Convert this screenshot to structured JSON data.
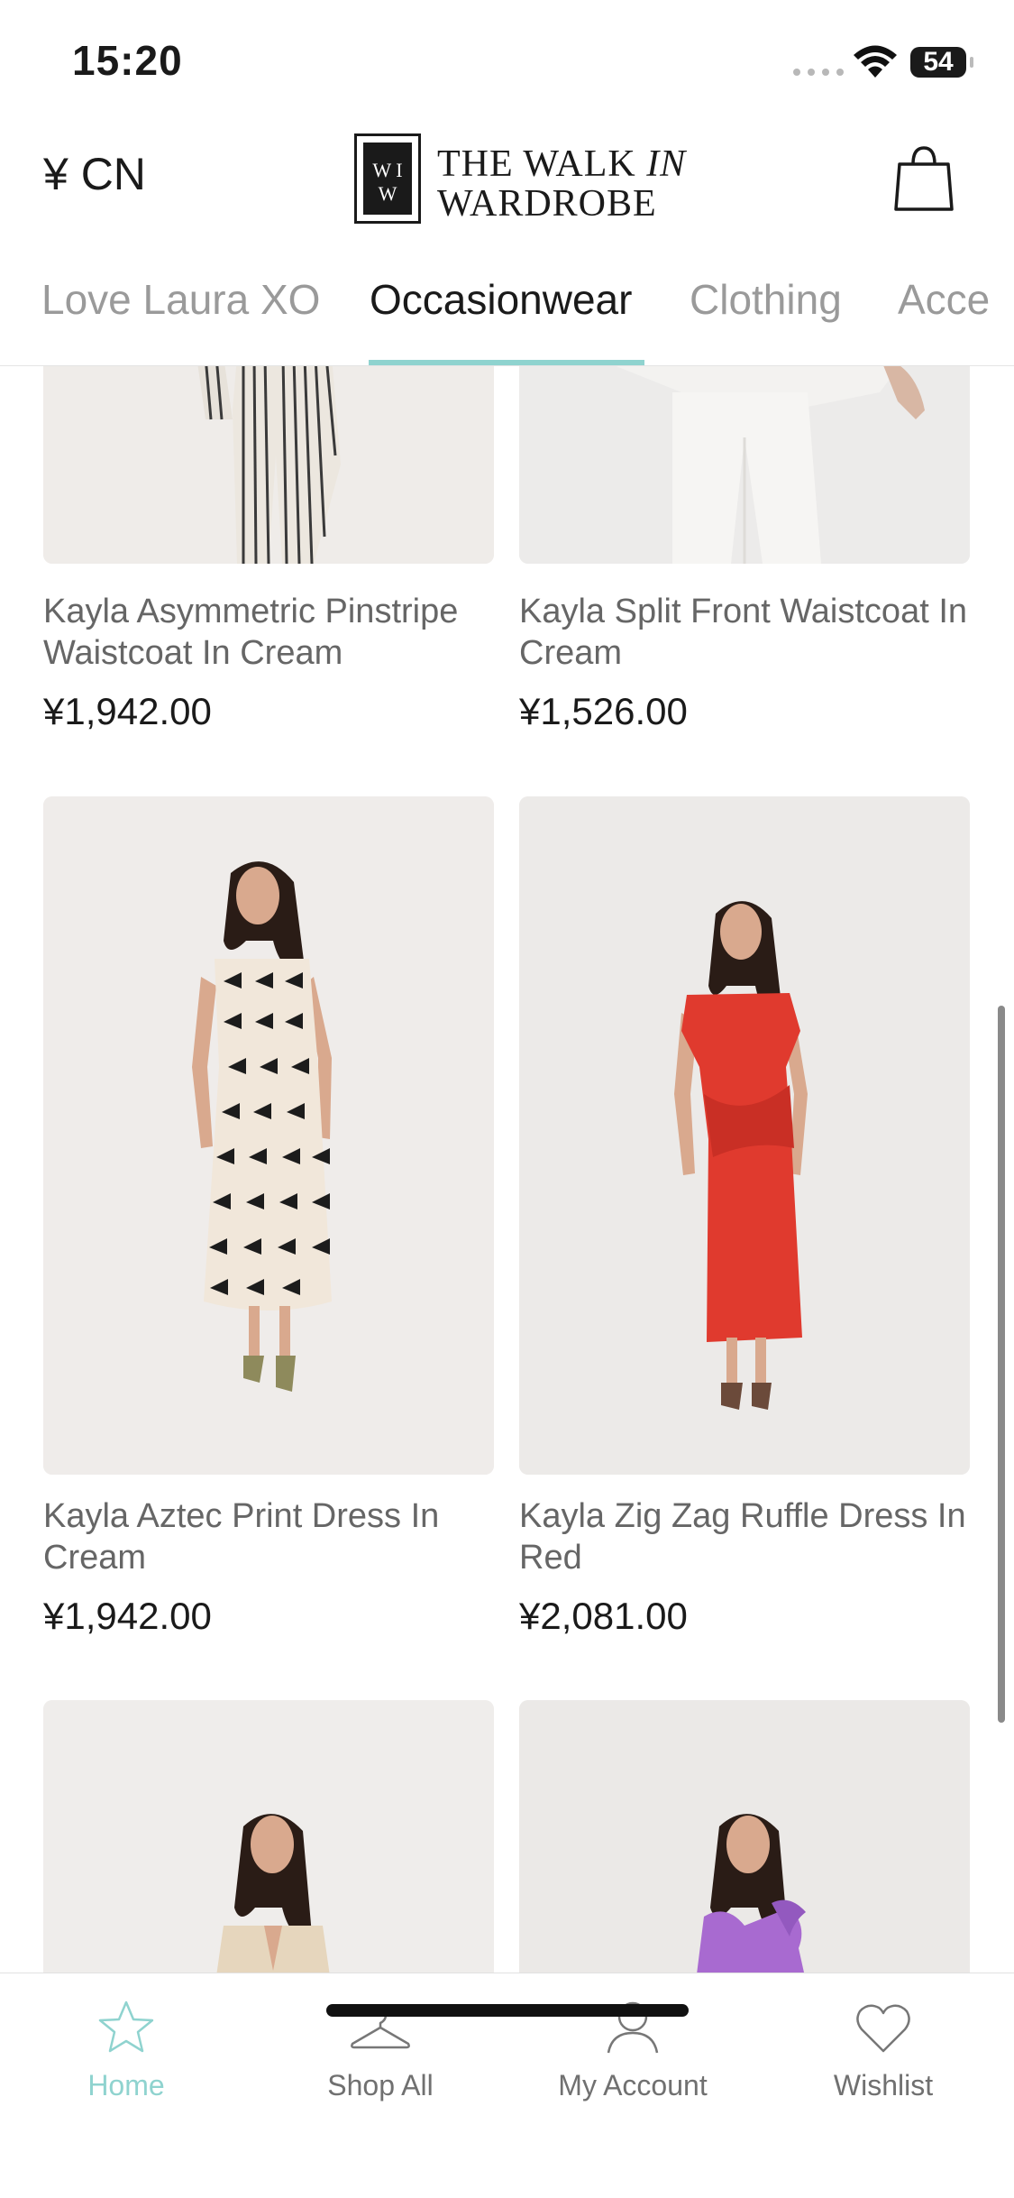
{
  "status_bar": {
    "time": "15:20",
    "battery": "54"
  },
  "header": {
    "currency": "¥ CN",
    "logo": {
      "mark": "W I W",
      "line1": "THE WALK",
      "line1_italic": "IN",
      "line2": "WARDROBE"
    }
  },
  "tabs": [
    {
      "label": "Love Laura XO"
    },
    {
      "label": "Occasionwear"
    },
    {
      "label": "Clothing"
    },
    {
      "label": "Acce"
    }
  ],
  "active_tab": "Occasionwear",
  "products": [
    {
      "title": "Kayla Asymmetric Pinstripe Waistcoat In Cream",
      "price": "¥1,942.00"
    },
    {
      "title": "Kayla Split Front Waistcoat In Cream",
      "price": "¥1,526.00"
    },
    {
      "title": "Kayla Aztec Print Dress In Cream",
      "price": "¥1,942.00"
    },
    {
      "title": "Kayla Zig Zag Ruffle Dress In Red",
      "price": "¥2,081.00"
    }
  ],
  "nav": [
    {
      "label": "Home",
      "icon": "star-icon",
      "active": true
    },
    {
      "label": "Shop All",
      "icon": "hanger-icon",
      "active": false
    },
    {
      "label": "My Account",
      "icon": "person-icon",
      "active": false
    },
    {
      "label": "Wishlist",
      "icon": "heart-icon",
      "active": false
    }
  ],
  "colors": {
    "accent": "#8fd3cf",
    "dress_red": "#e03a2e",
    "dress_lilac": "#a86ad0"
  }
}
